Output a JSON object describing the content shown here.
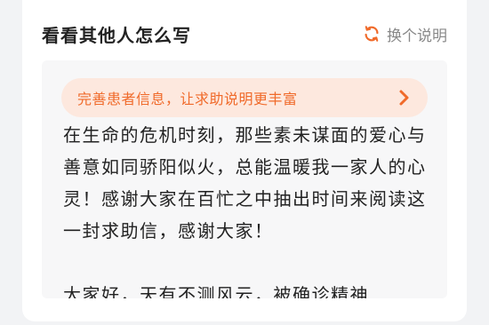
{
  "header": {
    "title": "看看其他人怎么写",
    "switch_label": "换个说明"
  },
  "banner": {
    "text": "完善患者信息，让求助说明更丰富"
  },
  "story": {
    "paragraphs": [
      "在生命的危机时刻，那些素未谋面的爱心与善意如同骄阳似火，总能温暖我一家人的心灵！感谢大家在百忙之中抽出时间来阅读这一封求助信，感谢大家！",
      "大家好，天有不测风云，被确诊精神"
    ]
  },
  "colors": {
    "accent": "#f06a2a",
    "banner_bg": "#fde8de",
    "panel_bg": "#f7f7f8"
  },
  "icons": {
    "switch": "refresh-icon",
    "banner": "chevron-right-icon"
  }
}
